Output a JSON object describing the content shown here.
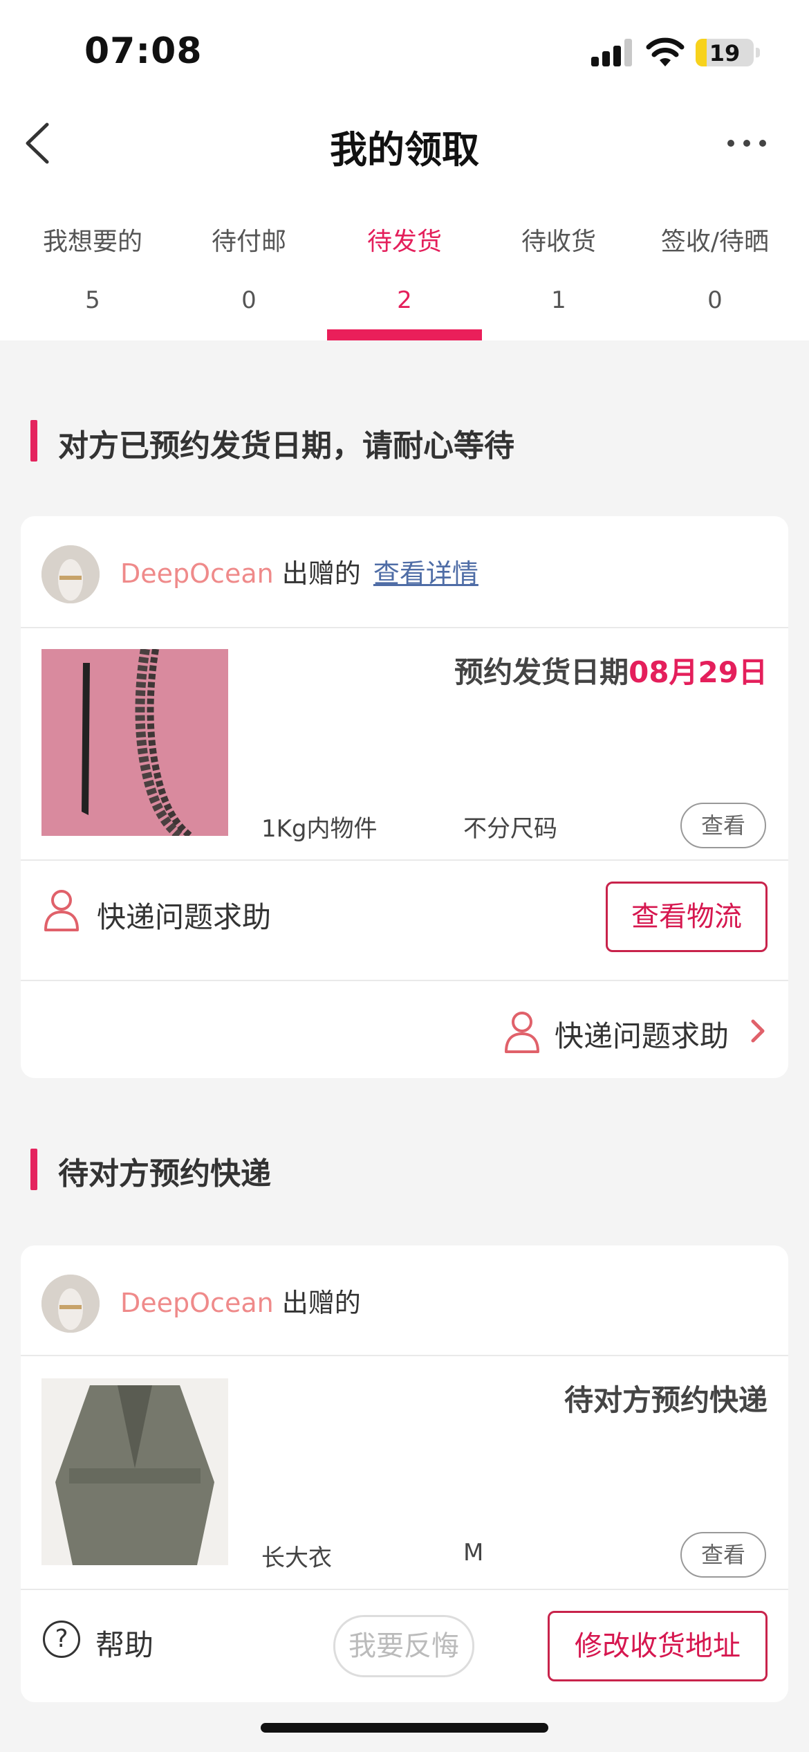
{
  "status_bar": {
    "time": "07:08",
    "battery": "19",
    "battery_level": 0.19
  },
  "nav": {
    "title": "我的领取"
  },
  "tabs": [
    {
      "label": "我想要的",
      "count": "5"
    },
    {
      "label": "待付邮",
      "count": "0"
    },
    {
      "label": "待发货",
      "count": "2"
    },
    {
      "label": "待收货",
      "count": "1"
    },
    {
      "label": "签收/待晒",
      "count": "0"
    }
  ],
  "active_tab": "待发货",
  "sections": [
    {
      "title": "对方已预约发货日期，请耐心等待",
      "card": {
        "giver_name": "DeepOcean",
        "giver_suffix": "出赠的",
        "detail_link": "查看详情",
        "status_prefix": "预约发货日期",
        "status_date": "08月29日",
        "item_name": "1Kg内物件",
        "item_size": "不分尺码",
        "view_label": "查看",
        "help_label": "快递问题求助",
        "logistics_button": "查看物流",
        "footer_help_label": "快递问题求助"
      }
    },
    {
      "title": "待对方预约快递",
      "card": {
        "giver_name": "DeepOcean",
        "giver_suffix": "出赠的",
        "status_text": "待对方预约快递",
        "item_name": "长大衣",
        "item_size": "M",
        "view_label": "查看",
        "help_label": "帮助",
        "regret_button": "我要反悔",
        "address_button": "修改收货地址"
      }
    }
  ],
  "colors": {
    "accent": "#e41f5b",
    "giver_name": "#ef8a8a",
    "link": "#4f6da6"
  }
}
